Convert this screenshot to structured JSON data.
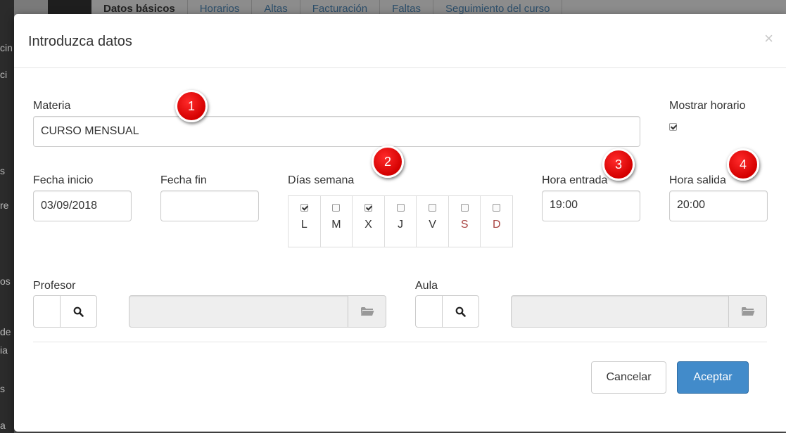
{
  "background": {
    "tabs": [
      "Datos básicos",
      "Horarios",
      "Altas",
      "Facturación",
      "Faltas",
      "Seguimiento del curso"
    ],
    "active_tab": 0
  },
  "modal": {
    "title": "Introduzca datos",
    "close_label": "×"
  },
  "form": {
    "materia": {
      "label": "Materia",
      "value": "CURSO MENSUAL"
    },
    "mostrar_horario": {
      "label": "Mostrar horario",
      "checked": true
    },
    "fecha_inicio": {
      "label": "Fecha inicio",
      "value": "03/09/2018"
    },
    "fecha_fin": {
      "label": "Fecha fin",
      "value": ""
    },
    "dias_semana": {
      "label": "Días semana",
      "days": [
        {
          "letter": "L",
          "checked": true,
          "weekend": false
        },
        {
          "letter": "M",
          "checked": false,
          "weekend": false
        },
        {
          "letter": "X",
          "checked": true,
          "weekend": false
        },
        {
          "letter": "J",
          "checked": false,
          "weekend": false
        },
        {
          "letter": "V",
          "checked": false,
          "weekend": false
        },
        {
          "letter": "S",
          "checked": false,
          "weekend": true
        },
        {
          "letter": "D",
          "checked": false,
          "weekend": true
        }
      ]
    },
    "hora_entrada": {
      "label": "Hora entrada",
      "value": "19:00"
    },
    "hora_salida": {
      "label": "Hora salida",
      "value": "20:00"
    },
    "profesor": {
      "label": "Profesor",
      "code": "",
      "name": ""
    },
    "aula": {
      "label": "Aula",
      "code": "",
      "name": ""
    }
  },
  "footer": {
    "cancel_label": "Cancelar",
    "accept_label": "Aceptar"
  },
  "badges": [
    "1",
    "2",
    "3",
    "4"
  ],
  "colors": {
    "primary": "#428bca",
    "badge": "#e00000",
    "weekend": "#a94442"
  }
}
